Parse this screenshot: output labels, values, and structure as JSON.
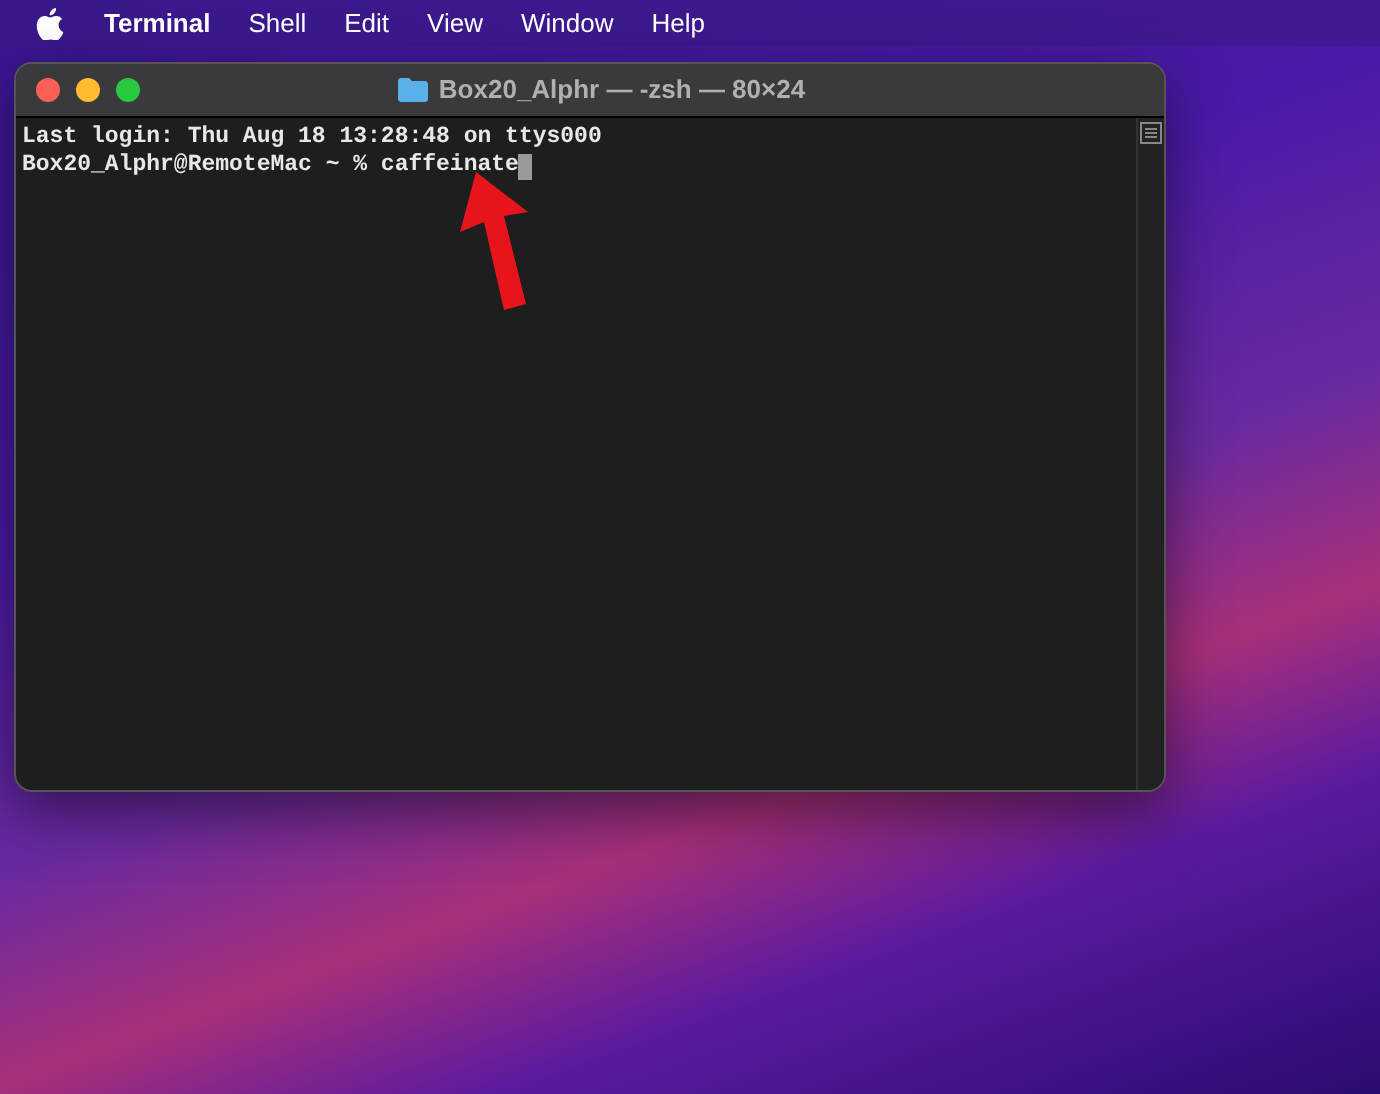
{
  "menu_bar": {
    "app_name": "Terminal",
    "items": [
      "Shell",
      "Edit",
      "View",
      "Window",
      "Help"
    ]
  },
  "window": {
    "title": "Box20_Alphr — -zsh — 80×24"
  },
  "terminal": {
    "lines": [
      "Last login: Thu Aug 18 13:28:48 on ttys000",
      "Box20_Alphr@RemoteMac ~ % caffeinate"
    ]
  }
}
